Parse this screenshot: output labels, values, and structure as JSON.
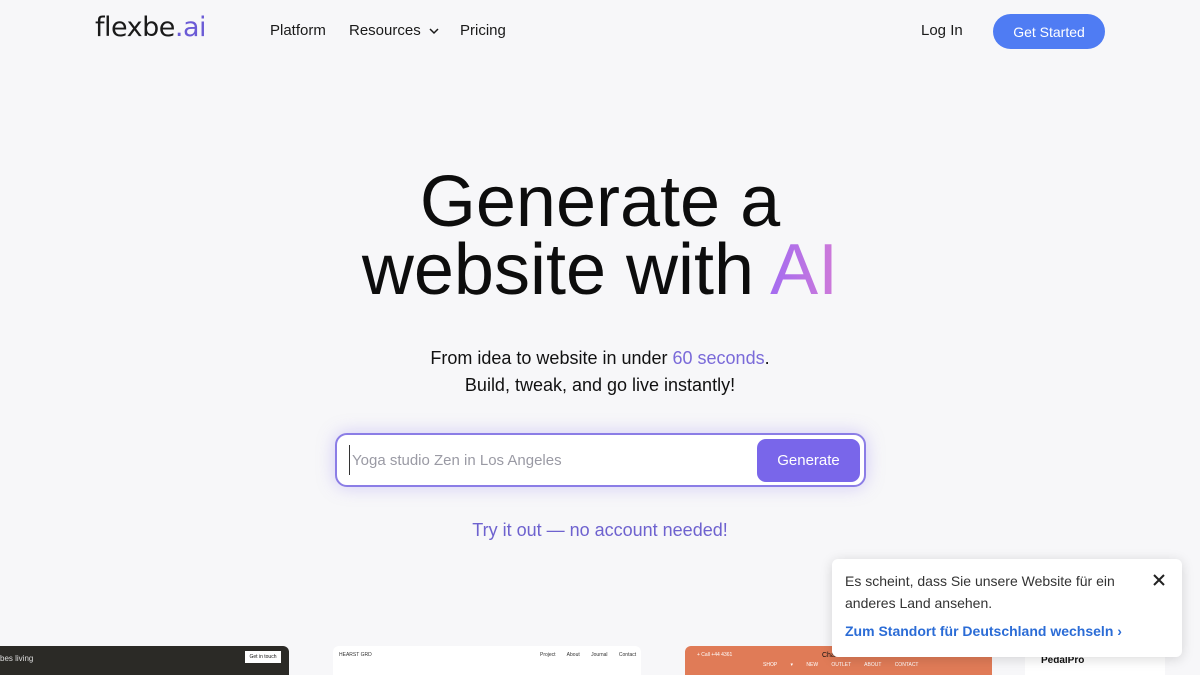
{
  "header": {
    "logo_main": "flexbe",
    "logo_accent": ".ai",
    "nav": {
      "platform": "Platform",
      "resources": "Resources",
      "pricing": "Pricing"
    },
    "login": "Log In",
    "cta": "Get Started"
  },
  "hero": {
    "title_line1": "Generate a",
    "title_line2": "website with",
    "title_ai": "AI",
    "subtitle_pre": "From idea to website in under ",
    "subtitle_highlight": "60 seconds",
    "subtitle_post": ".",
    "subtitle_line2": "Build, tweak, and go live instantly!",
    "input_placeholder": "Yoga studio Zen in Los Angeles",
    "generate_label": "Generate",
    "try_link": "Try it out — no account needed!"
  },
  "previews": {
    "card1": {
      "text": "bes living",
      "button": "Get in touch"
    },
    "card2": {
      "brand": "HEARST GRD",
      "links": "Project About Journal Contact"
    },
    "card3": {
      "brand": "+ Call +44 4361",
      "name": "Charlie",
      "menu": "SHOP ▾ NEW OUTLET ABOUT CONTACT"
    },
    "card4": {
      "brand": "PedalPro"
    }
  },
  "geo_popup": {
    "message": "Es scheint, dass Sie unsere Website für ein anderes Land ansehen.",
    "link": "Zum Standort für Deutschland wechseln ›"
  },
  "colors": {
    "background": "#f7f7f9",
    "primary_button": "#4f7cf3",
    "generate_button": "#7966ea",
    "accent_text": "#7a6ad9",
    "link_blue": "#2b6cd6"
  },
  "icons": {
    "resources_dropdown": "chevron-down-icon",
    "popup_close": "close-icon"
  }
}
